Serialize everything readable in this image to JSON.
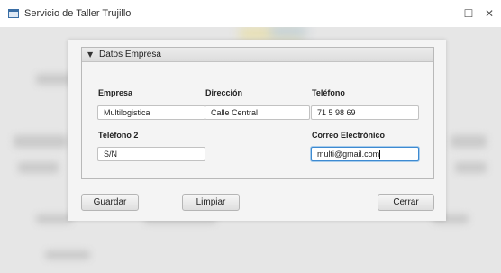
{
  "window": {
    "title": "Servicio de Taller Trujillo",
    "controls": {
      "minimize": "—",
      "maximize": "☐",
      "close": "✕"
    }
  },
  "dialog": {
    "section_title": "Datos Empresa",
    "section_expanded": true,
    "labels": {
      "empresa": "Empresa",
      "direccion": "Dirección",
      "telefono": "Teléfono",
      "telefono2": "Teléfono 2",
      "correo": "Correo Electrónico"
    },
    "values": {
      "empresa": "Multilogistica",
      "direccion": "Calle Central",
      "telefono": "71 5 98 69",
      "telefono2": "S/N",
      "correo": "multi@gmail.com"
    },
    "buttons": {
      "guardar": "Guardar",
      "limpiar": "Limpiar",
      "cerrar": "Cerrar"
    },
    "focused_field": "correo"
  },
  "colors": {
    "focus_border": "#3d8ad1",
    "panel_header": "#dcdcdc"
  }
}
